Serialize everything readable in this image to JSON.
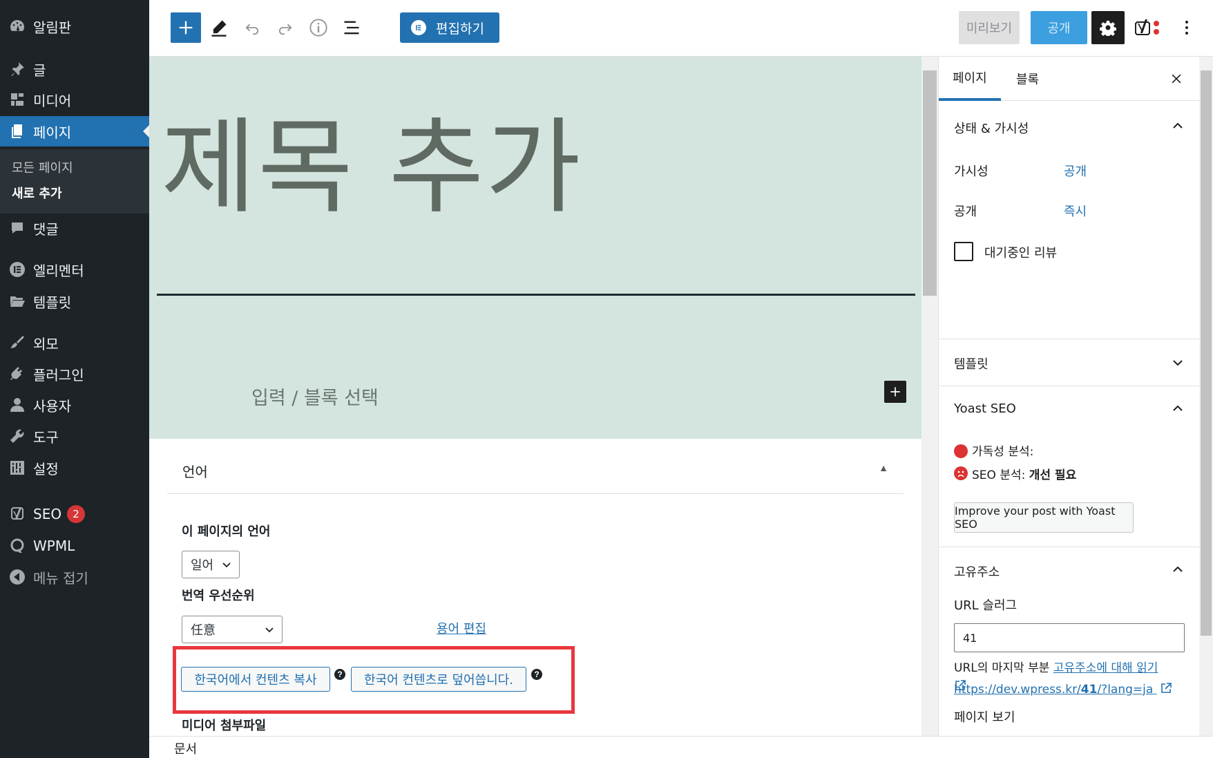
{
  "sidebar": {
    "items": [
      {
        "label": "알림판",
        "icon": "dashboard-icon"
      },
      {
        "label": "글",
        "icon": "pin-icon"
      },
      {
        "label": "미디어",
        "icon": "media-icon"
      },
      {
        "label": "페이지",
        "icon": "pages-icon"
      },
      {
        "label": "댓글",
        "icon": "comments-icon"
      },
      {
        "label": "엘리멘터",
        "icon": "elementor-icon"
      },
      {
        "label": "템플릿",
        "icon": "folder-icon"
      },
      {
        "label": "외모",
        "icon": "appearance-icon"
      },
      {
        "label": "플러그인",
        "icon": "plugins-icon"
      },
      {
        "label": "사용자",
        "icon": "users-icon"
      },
      {
        "label": "도구",
        "icon": "tools-icon"
      },
      {
        "label": "설정",
        "icon": "settings-icon"
      },
      {
        "label": "SEO",
        "icon": "yoast-icon",
        "badge": "2"
      },
      {
        "label": "WPML",
        "icon": "wpml-icon"
      },
      {
        "label": "메뉴 접기",
        "icon": "collapse-icon"
      }
    ],
    "submenu": [
      "모든 페이지",
      "새로 추가"
    ]
  },
  "toolbar": {
    "elementor_label": "편집하기",
    "preview_label": "미리보기",
    "publish_label": "공개"
  },
  "canvas": {
    "title_placeholder": "제목 추가",
    "block_placeholder": "입력 / 블록 선택"
  },
  "metabox": {
    "title": "언어",
    "page_language_label": "이 페이지의 언어",
    "page_language_value": "일어",
    "priority_label": "번역 우선순위",
    "priority_value": "任意",
    "edit_terms_link": "용어 편집",
    "copy_button": "한국어에서 컨텐츠 복사",
    "overwrite_button": "한국어 컨텐츠로 덮어씁니다.",
    "help_glyph": "?",
    "media_label": "미디어 첨부파일"
  },
  "status_bar": {
    "breadcrumb": "문서"
  },
  "settings_panel": {
    "tabs": [
      "페이지",
      "블록"
    ],
    "status_section": {
      "title": "상태 & 가시성",
      "visibility_label": "가시성",
      "visibility_value": "공개",
      "publish_label": "공개",
      "publish_value": "즉시",
      "pending_review_label": "대기중인 리뷰"
    },
    "template_section": {
      "title": "템플릿"
    },
    "yoast_section": {
      "title": "Yoast SEO",
      "readability_label": "가독성 분석:",
      "seo_label": "SEO 분석:",
      "seo_value": "개선 필요",
      "improve_button": "Improve your post with Yoast SEO"
    },
    "permalink_section": {
      "title": "고유주소",
      "slug_label": "URL 슬러그",
      "slug_value": "41",
      "help_text": "URL의 마지막 부분 ",
      "help_link": "고유주소에 대해 읽기",
      "view_page_label": "페이지 보기",
      "view_link_prefix": "https://dev.wpress.kr/",
      "view_link_bold": "41",
      "view_link_suffix": "/?lang=ja"
    }
  },
  "colors": {
    "accent": "#2271b1",
    "admin_bg": "#1d2327",
    "canvas_bg": "#d3e5de",
    "highlight": "#e8373d",
    "yoast_red": "#dc3232"
  }
}
